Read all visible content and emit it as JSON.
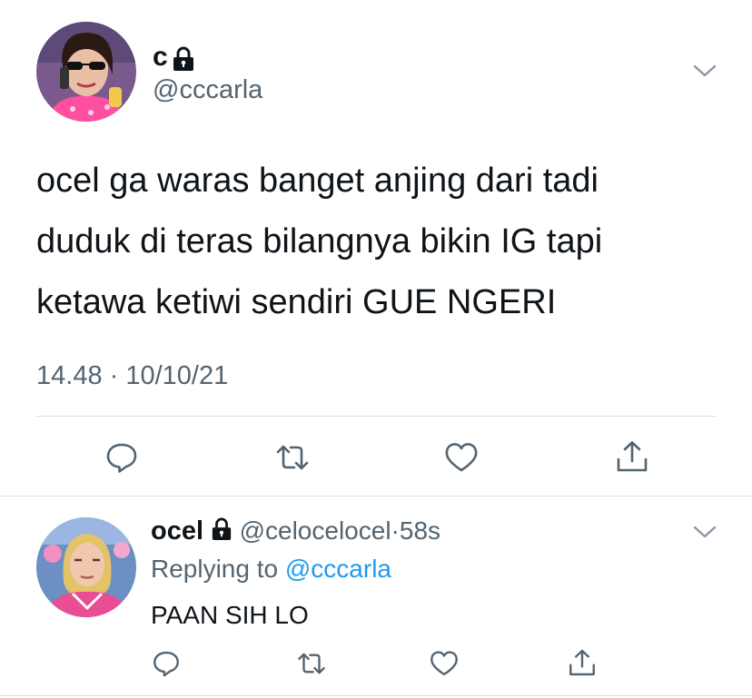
{
  "main_tweet": {
    "author": {
      "display_name": "c",
      "handle": "@cccarla",
      "avatar_icon": "avatar-woman-sunglasses-phone",
      "lock_icon": "lock-icon"
    },
    "text_lines": [
      "ocel ga waras banget anjing dari tadi",
      "duduk di teras bilangnya bikin IG tapi",
      "ketawa ketiwi sendiri GUE NGERI"
    ],
    "timestamp": "14.48 · 10/10/21",
    "actions": [
      "reply-icon",
      "retweet-icon",
      "like-icon",
      "share-icon"
    ]
  },
  "reply_tweet": {
    "author": {
      "display_name": "ocel",
      "handle": "@celocelocel",
      "separator": "·",
      "time_ago": "58s",
      "avatar_icon": "avatar-blonde-woman-pink-jacket",
      "lock_icon": "lock-icon"
    },
    "replying_prefix": "Replying to ",
    "replying_mention": "@cccarla",
    "text": "PAAN SIH LO",
    "actions": [
      "reply-icon",
      "retweet-icon",
      "like-icon",
      "share-icon"
    ]
  },
  "colors": {
    "text_primary": "#0f1419",
    "text_secondary": "#536471",
    "link": "#1d9bf0",
    "divider": "#d9dee3"
  }
}
